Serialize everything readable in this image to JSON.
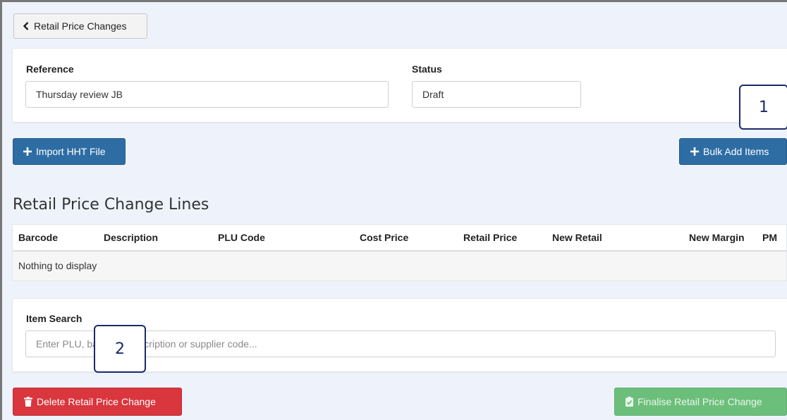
{
  "nav": {
    "back_label": "Retail Price Changes"
  },
  "header": {
    "reference_label": "Reference",
    "reference_value": "Thursday review JB",
    "status_label": "Status",
    "status_value": "Draft"
  },
  "actions": {
    "import_label": "Import HHT File",
    "bulk_add_label": "Bulk Add Items"
  },
  "lines": {
    "title": "Retail Price Change Lines",
    "columns": [
      "Barcode",
      "Description",
      "PLU Code",
      "Cost Price",
      "Retail Price",
      "New Retail",
      "New Margin",
      "PM"
    ],
    "empty_message": "Nothing to display"
  },
  "search": {
    "label": "Item Search",
    "placeholder": "Enter PLU, barcode, description or supplier code..."
  },
  "footer": {
    "delete_label": "Delete Retail Price Change",
    "finalise_label": "Finalise Retail Price Change"
  },
  "callouts": [
    "1",
    "2"
  ],
  "colors": {
    "primary": "#2e6da4",
    "danger": "#d9363e",
    "success": "#6cbf7b",
    "callout": "#1b2a6b"
  },
  "icons": {
    "back": "chevron-left-icon",
    "plus": "plus-icon",
    "trash": "trash-icon",
    "check": "clipboard-check-icon"
  }
}
